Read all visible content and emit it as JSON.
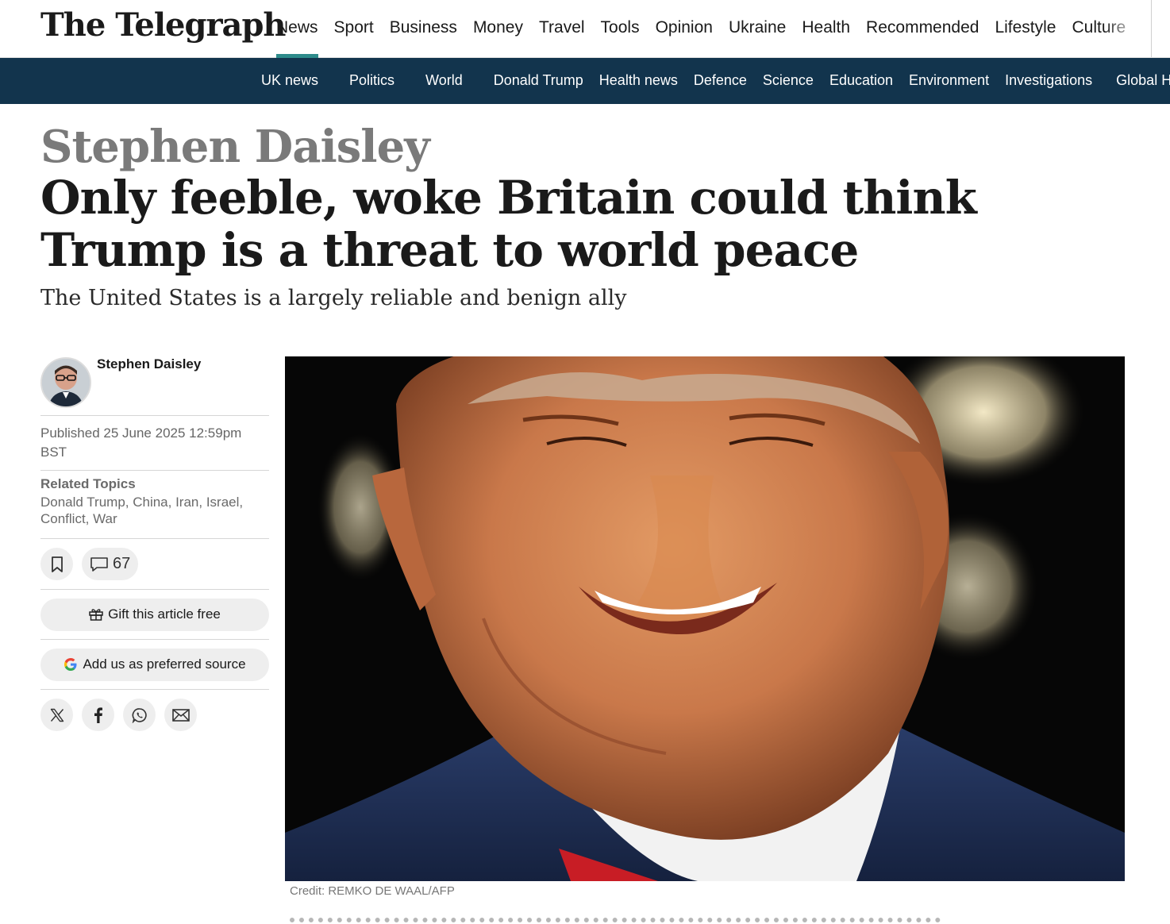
{
  "header": {
    "logo": "The Telegraph",
    "nav": [
      "News",
      "Sport",
      "Business",
      "Money",
      "Travel",
      "Tools",
      "Opinion",
      "Ukraine",
      "Health",
      "Recommended",
      "Lifestyle",
      "Culture"
    ],
    "active": "News",
    "accent_color": "#2e8b8b"
  },
  "subnav": {
    "items": [
      "UK news",
      "Politics",
      "World",
      "Donald Trump",
      "Health news",
      "Defence",
      "Science",
      "Education",
      "Environment",
      "Investigations",
      "Global Health"
    ],
    "background": "#12344d"
  },
  "article": {
    "kicker": "Stephen Daisley",
    "headline": "Only feeble, woke Britain could think Trump is a threat to world peace",
    "standfirst": "The United States is a largely reliable and benign ally",
    "author": "Stephen Daisley",
    "published": "Published 25 June 2025 12:59pm BST",
    "related_title": "Related Topics",
    "related_topics": "Donald Trump, China, Iran, Israel, Conflict, War",
    "comment_count": "67",
    "gift_label": "Gift this article free",
    "preferred_label": "Add us as preferred source",
    "share_icons": [
      "x-icon",
      "facebook-icon",
      "whatsapp-icon",
      "email-icon"
    ],
    "photo_credit": "Credit: REMKO DE WAAL/AFP"
  }
}
